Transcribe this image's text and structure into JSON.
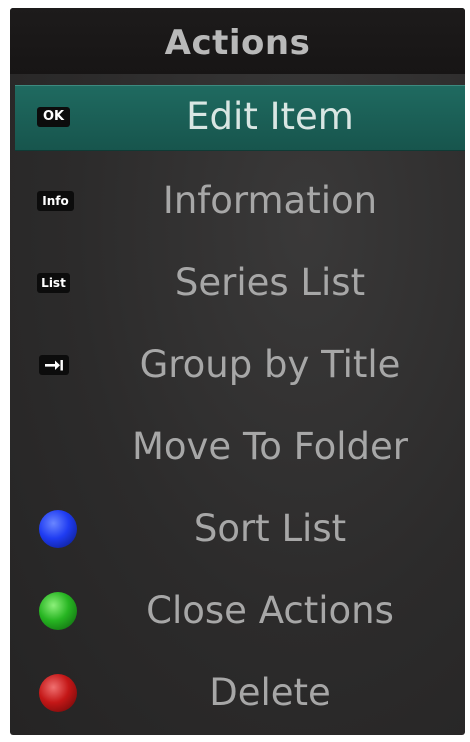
{
  "header": {
    "title": "Actions"
  },
  "menu": {
    "items": [
      {
        "label": "Edit Item",
        "key": "OK",
        "selected": true
      },
      {
        "label": "Information",
        "key": "Info"
      },
      {
        "label": "Series List",
        "key": "List"
      },
      {
        "label": "Group by Title",
        "key_icon": "arrow-to-bar-icon"
      },
      {
        "label": "Move To Folder"
      },
      {
        "label": "Sort List",
        "key_icon": "blue-button-icon",
        "key_color": "#1f3cf2"
      },
      {
        "label": "Close Actions",
        "key_icon": "green-button-icon",
        "key_color": "#27b522"
      },
      {
        "label": "Delete",
        "key_icon": "red-button-icon",
        "key_color": "#c41717"
      }
    ]
  },
  "theme": {
    "panel_bg": "#2c2b2b",
    "header_bg": "#1b1919",
    "selected_bg": "#1f6a60",
    "text": "#a7a7a7",
    "header_text": "#b9b9b9"
  }
}
